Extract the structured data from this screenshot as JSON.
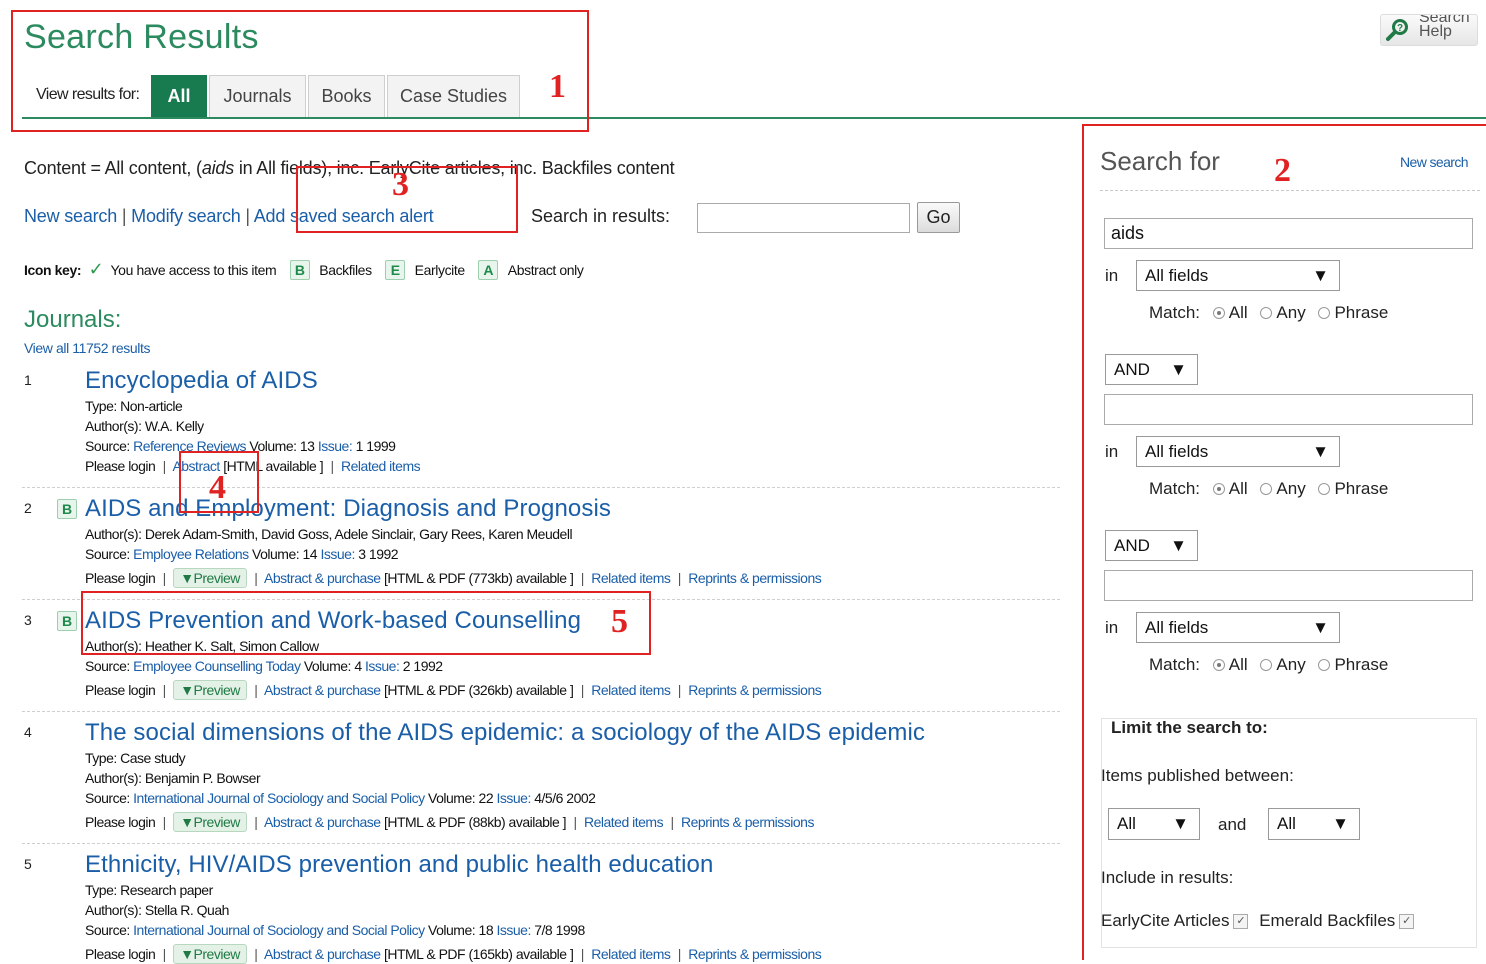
{
  "header": {
    "title": "Search Results",
    "help_label_1": "Search",
    "help_label_2": "Help",
    "view_results_label": "View results for:",
    "tabs": [
      "All",
      "Journals",
      "Books",
      "Case Studies"
    ]
  },
  "annotations": [
    "1",
    "2",
    "3",
    "4",
    "5"
  ],
  "summary": {
    "prefix": "Content = All content, (",
    "term": "aids",
    "suffix": " in All fields), inc. EarlyCite articles, inc. Backfiles content"
  },
  "actions": {
    "new_search": "New search",
    "modify_search": "Modify search",
    "add_alert": "Add saved search alert",
    "search_in_results": "Search in results:",
    "go": "Go",
    "sep": "|"
  },
  "icon_key": {
    "label": "Icon key:",
    "access": "You have access to this item",
    "b": "B",
    "b_label": "Backfiles",
    "e": "E",
    "e_label": "Earlycite",
    "a": "A",
    "a_label": "Abstract only"
  },
  "journals": {
    "heading": "Journals:",
    "view_all": "View all 11752 results"
  },
  "results": [
    {
      "num": "1",
      "badge": "",
      "title": "Encyclopedia of AIDS",
      "type": "Type: Non-article",
      "authors": "Author(s): W.A. Kelly",
      "source_label": "Source: ",
      "source": "Reference Reviews",
      "vol_label": " Volume: 13 ",
      "issue_label": "Issue:",
      "issue": " 1 1999",
      "login": "Please login",
      "abstract": "Abstract",
      "html": "[HTML available ]",
      "related": "Related items"
    },
    {
      "num": "2",
      "badge": "B",
      "title": "AIDS and Employment: Diagnosis and Prognosis",
      "authors": "Author(s): Derek Adam-Smith, David Goss, Adele Sinclair, Gary Rees, Karen Meudell",
      "source_label": "Source: ",
      "source": "Employee Relations",
      "vol_label": " Volume: 14 ",
      "issue_label": "Issue:",
      "issue": " 3 1992",
      "login": "Please login",
      "preview": "▼Preview",
      "abstract": "Abstract & purchase",
      "html": "[HTML & PDF (773kb) available ]",
      "related": "Related items",
      "reprints": "Reprints & permissions"
    },
    {
      "num": "3",
      "badge": "B",
      "title": "AIDS Prevention and Work-based Counselling",
      "authors": "Author(s): Heather K. Salt, Simon Callow",
      "source_label": "Source: ",
      "source": "Employee Counselling Today",
      "vol_label": " Volume: 4 ",
      "issue_label": "Issue:",
      "issue": " 2 1992",
      "login": "Please login",
      "preview": "▼Preview",
      "abstract": "Abstract & purchase",
      "html": "[HTML & PDF (326kb) available ]",
      "related": "Related items",
      "reprints": "Reprints & permissions"
    },
    {
      "num": "4",
      "badge": "",
      "title": "The social dimensions of the AIDS epidemic: a sociology of the AIDS epidemic",
      "type": "Type: Case study",
      "authors": "Author(s): Benjamin P. Bowser",
      "source_label": "Source: ",
      "source": "International Journal of Sociology and Social Policy",
      "vol_label": " Volume: 22 ",
      "issue_label": "Issue:",
      "issue": " 4/5/6 2002",
      "login": "Please login",
      "preview": "▼Preview",
      "abstract": "Abstract & purchase",
      "html": "[HTML & PDF (88kb) available ]",
      "related": "Related items",
      "reprints": "Reprints & permissions"
    },
    {
      "num": "5",
      "badge": "",
      "title": "Ethnicity, HIV/AIDS prevention and public health education",
      "type": "Type: Research paper",
      "authors": "Author(s): Stella R. Quah",
      "source_label": "Source: ",
      "source": "International Journal of Sociology and Social Policy",
      "vol_label": " Volume: 18 ",
      "issue_label": "Issue:",
      "issue": " 7/8 1998",
      "login": "Please login",
      "preview": "▼Preview",
      "abstract": "Abstract & purchase",
      "html": "[HTML & PDF (165kb) available ]",
      "related": "Related items",
      "reprints": "Reprints & permissions"
    }
  ],
  "sidebar": {
    "title": "Search for",
    "new_search": "New search",
    "term1": "aids",
    "in": "in",
    "field": "All fields",
    "match": "Match:",
    "opt_all": "All",
    "opt_any": "Any",
    "opt_phrase": "Phrase",
    "op": "AND",
    "limit_title": "Limit the search to:",
    "published_between": "Items published between:",
    "from": "All",
    "and": "and",
    "to": "All",
    "include": "Include in results:",
    "earlycite": "EarlyCite Articles",
    "backfiles": "Emerald Backfiles",
    "check": "✓"
  }
}
